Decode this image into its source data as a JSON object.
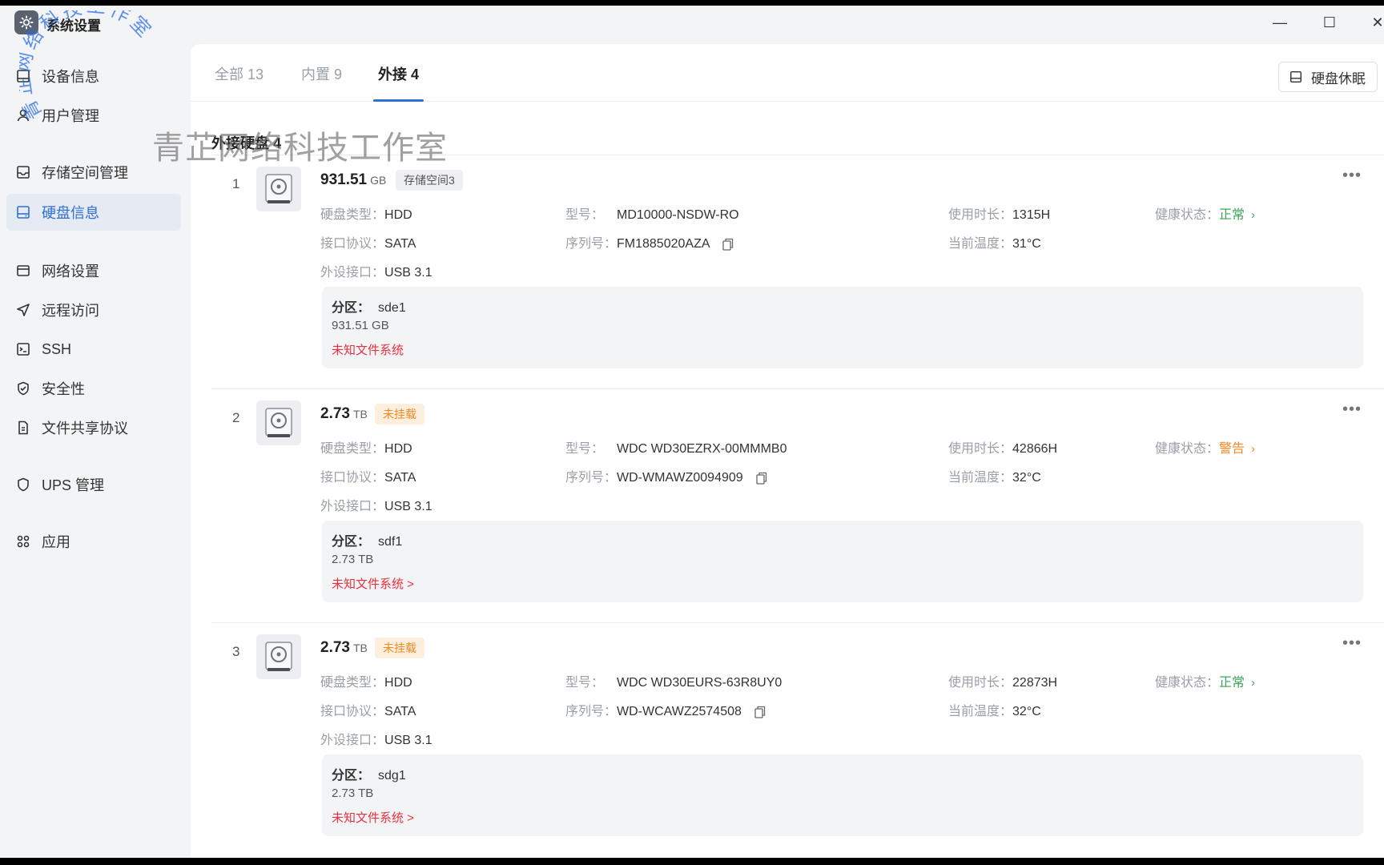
{
  "window": {
    "title": "系统设置",
    "controls": {
      "minimize": "—",
      "maximize": "☐",
      "close": "✕"
    }
  },
  "sidebar": {
    "items": [
      {
        "label": "设备信息",
        "icon": "device-info-icon"
      },
      {
        "label": "用户管理",
        "icon": "user-icon"
      },
      {
        "label": "存储空间管理",
        "icon": "storage-icon"
      },
      {
        "label": "硬盘信息",
        "icon": "disk-icon",
        "active": true
      },
      {
        "label": "网络设置",
        "icon": "network-icon"
      },
      {
        "label": "远程访问",
        "icon": "remote-icon"
      },
      {
        "label": "SSH",
        "icon": "ssh-icon"
      },
      {
        "label": "安全性",
        "icon": "shield-icon"
      },
      {
        "label": "文件共享协议",
        "icon": "file-share-icon"
      },
      {
        "label": "UPS 管理",
        "icon": "ups-icon"
      },
      {
        "label": "应用",
        "icon": "apps-icon"
      }
    ]
  },
  "tabs": [
    {
      "label": "全部 13"
    },
    {
      "label": "内置 9"
    },
    {
      "label": "外接 4",
      "active": true
    }
  ],
  "sleep_button": {
    "label": "硬盘休眠"
  },
  "section": {
    "title": "外接硬盘 4"
  },
  "labels": {
    "disk_type": "硬盘类型：",
    "interface": "接口协议：",
    "external_port": "外设接口：",
    "model": "型号：",
    "serial": "序列号：",
    "usage_time": "使用时长：",
    "temperature": "当前温度：",
    "health": "健康状态：",
    "partition": "分区："
  },
  "disks": [
    {
      "index": "1",
      "size": "931.51",
      "unit": "GB",
      "badge": "存储空间3",
      "badge_style": "gray",
      "disk_type": "HDD",
      "interface": "SATA",
      "external_port": "USB 3.1",
      "model": "MD10000-NSDW-RO",
      "serial": "FM1885020AZA",
      "usage_time": "1315H",
      "temperature": "31°C",
      "health": "正常",
      "health_style": "ok",
      "partition": {
        "name": "sde1",
        "size": "931.51 GB",
        "fs": "未知文件系统"
      }
    },
    {
      "index": "2",
      "size": "2.73",
      "unit": "TB",
      "badge": "未挂载",
      "badge_style": "orange",
      "disk_type": "HDD",
      "interface": "SATA",
      "external_port": "USB 3.1",
      "model": "WDC WD30EZRX-00MMMB0",
      "serial": "WD-WMAWZ0094909",
      "usage_time": "42866H",
      "temperature": "32°C",
      "health": "警告",
      "health_style": "warn",
      "partition": {
        "name": "sdf1",
        "size": "2.73 TB",
        "fs": "未知文件系统 >"
      }
    },
    {
      "index": "3",
      "size": "2.73",
      "unit": "TB",
      "badge": "未挂载",
      "badge_style": "orange",
      "disk_type": "HDD",
      "interface": "SATA",
      "external_port": "USB 3.1",
      "model": "WDC WD30EURS-63R8UY0",
      "serial": "WD-WCAWZ2574508",
      "usage_time": "22873H",
      "temperature": "32°C",
      "health": "正常",
      "health_style": "ok",
      "partition": {
        "name": "sdg1",
        "size": "2.73 TB",
        "fs": "未知文件系统 >"
      }
    }
  ],
  "watermark": {
    "text": "青芷网络科技工作室",
    "stamp_text": "青芷网络科技工作室"
  }
}
